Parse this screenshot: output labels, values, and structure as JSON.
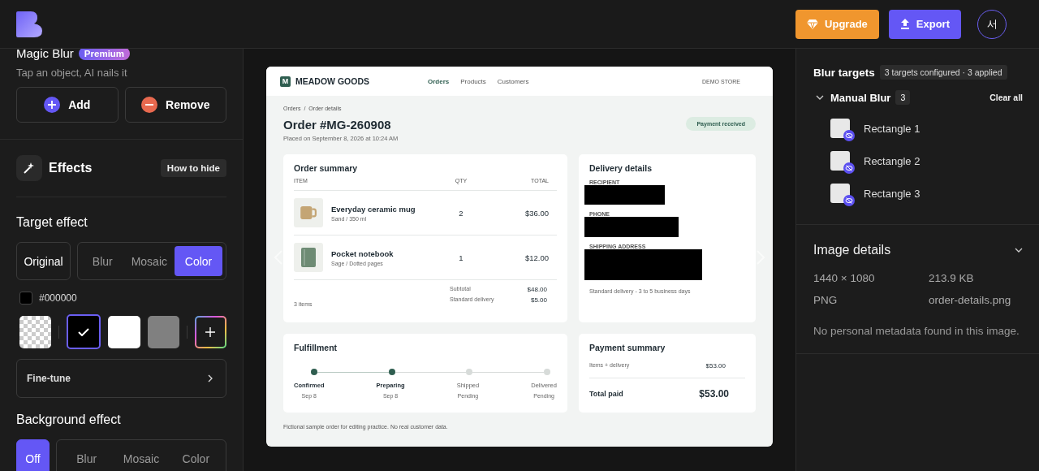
{
  "header": {
    "buttons": [
      {
        "label": "Upgrade",
        "kind": "upgrade"
      },
      {
        "label": "Export",
        "kind": "export"
      }
    ],
    "avatar": "서"
  },
  "left_panel": {
    "magic_blur": {
      "title": "Magic Blur",
      "badge": "Premium",
      "subtitle": "Tap an object, AI nails it",
      "buttons": [
        {
          "label": "Add",
          "kind": "add"
        },
        {
          "label": "Remove",
          "kind": "remove"
        }
      ]
    },
    "effects": {
      "title": "Effects",
      "help_button": "How to hide"
    },
    "target_effect": {
      "title": "Target effect",
      "original": {
        "label": "Original",
        "selected": false
      },
      "options": [
        {
          "label": "Blur",
          "selected": false
        },
        {
          "label": "Mosaic",
          "selected": false
        },
        {
          "label": "Color",
          "selected": true
        }
      ]
    },
    "current_color": {
      "color": "#000000",
      "hex": "#000000"
    },
    "swatches": [
      {
        "kind": "transparent",
        "selected": false
      },
      {
        "kind": "color",
        "color": "#000000",
        "selected": true
      },
      {
        "kind": "color",
        "color": "#ffffff",
        "selected": false
      },
      {
        "kind": "color",
        "color": "#808080",
        "selected": false
      },
      {
        "kind": "add",
        "selected": false
      }
    ],
    "fine_tune": "Fine-tune",
    "background_effect": {
      "title": "Background effect",
      "off": {
        "label": "Off",
        "selected": true
      },
      "options": [
        {
          "label": "Blur",
          "selected": false
        },
        {
          "label": "Mosaic",
          "selected": false
        },
        {
          "label": "Color",
          "selected": false
        }
      ]
    }
  },
  "document": {
    "brand": {
      "letter": "M",
      "name": "MEADOW GOODS"
    },
    "nav": [
      {
        "label": "Orders",
        "selected": true
      },
      {
        "label": "Products",
        "selected": false
      },
      {
        "label": "Customers",
        "selected": false
      }
    ],
    "store_label": "DEMO STORE",
    "breadcrumb": [
      "Orders",
      "Order details"
    ],
    "breadcrumb_separator": "/",
    "title": "Order #MG-260908",
    "placed": "Placed on September 8, 2026 at 10:24 AM",
    "status": "Payment received",
    "order_summary": {
      "title": "Order summary",
      "columns": [
        "ITEM",
        "QTY",
        "TOTAL"
      ],
      "rows": [
        {
          "kind": "mug",
          "name": "Everyday ceramic mug",
          "variant": "Sand / 350 ml",
          "qty": "2",
          "total": "$36.00"
        },
        {
          "kind": "notebook",
          "name": "Pocket notebook",
          "variant": "Sage / Dotted pages",
          "qty": "1",
          "total": "$12.00"
        }
      ],
      "item_count": "3 items",
      "totals": [
        {
          "label": "Subtotal",
          "value": "$48.00"
        },
        {
          "label": "Standard delivery",
          "value": "$5.00"
        }
      ]
    },
    "delivery": {
      "title": "Delivery details",
      "fields": [
        {
          "label": "RECIPIENT",
          "redacted": true
        },
        {
          "label": "PHONE",
          "redacted": true
        },
        {
          "label": "SHIPPING ADDRESS",
          "redacted": true
        }
      ],
      "note": "Standard delivery - 3 to 5 business days"
    },
    "fulfillment": {
      "title": "Fulfillment",
      "steps": [
        {
          "label": "Confirmed",
          "date": "Sep 8",
          "done": true
        },
        {
          "label": "Preparing",
          "date": "Sep 8",
          "done": true
        },
        {
          "label": "Shipped",
          "date": "Pending",
          "done": false
        },
        {
          "label": "Delivered",
          "date": "Pending",
          "done": false
        }
      ]
    },
    "payment": {
      "title": "Payment summary",
      "line": {
        "label": "Items + delivery",
        "value": "$53.00"
      },
      "total": {
        "label": "Total paid",
        "value": "$53.00"
      }
    },
    "footnote": "Fictional sample order for editing practice. No real customer data."
  },
  "right_panel": {
    "blur_targets": {
      "title": "Blur targets",
      "badge": "3 targets configured · 3 applied",
      "group": {
        "title": "Manual Blur",
        "count": "3",
        "expanded": true,
        "clear": "Clear all",
        "items": [
          {
            "label": "Rectangle 1",
            "hidden": true
          },
          {
            "label": "Rectangle 2",
            "hidden": true
          },
          {
            "label": "Rectangle 3",
            "hidden": true
          }
        ]
      }
    },
    "image_details": {
      "title": "Image details",
      "expanded": false,
      "fields": [
        "1440 × 1080",
        "213.9 KB",
        "PNG",
        "order-details.png"
      ],
      "note": "No personal metadata found in this image."
    }
  }
}
